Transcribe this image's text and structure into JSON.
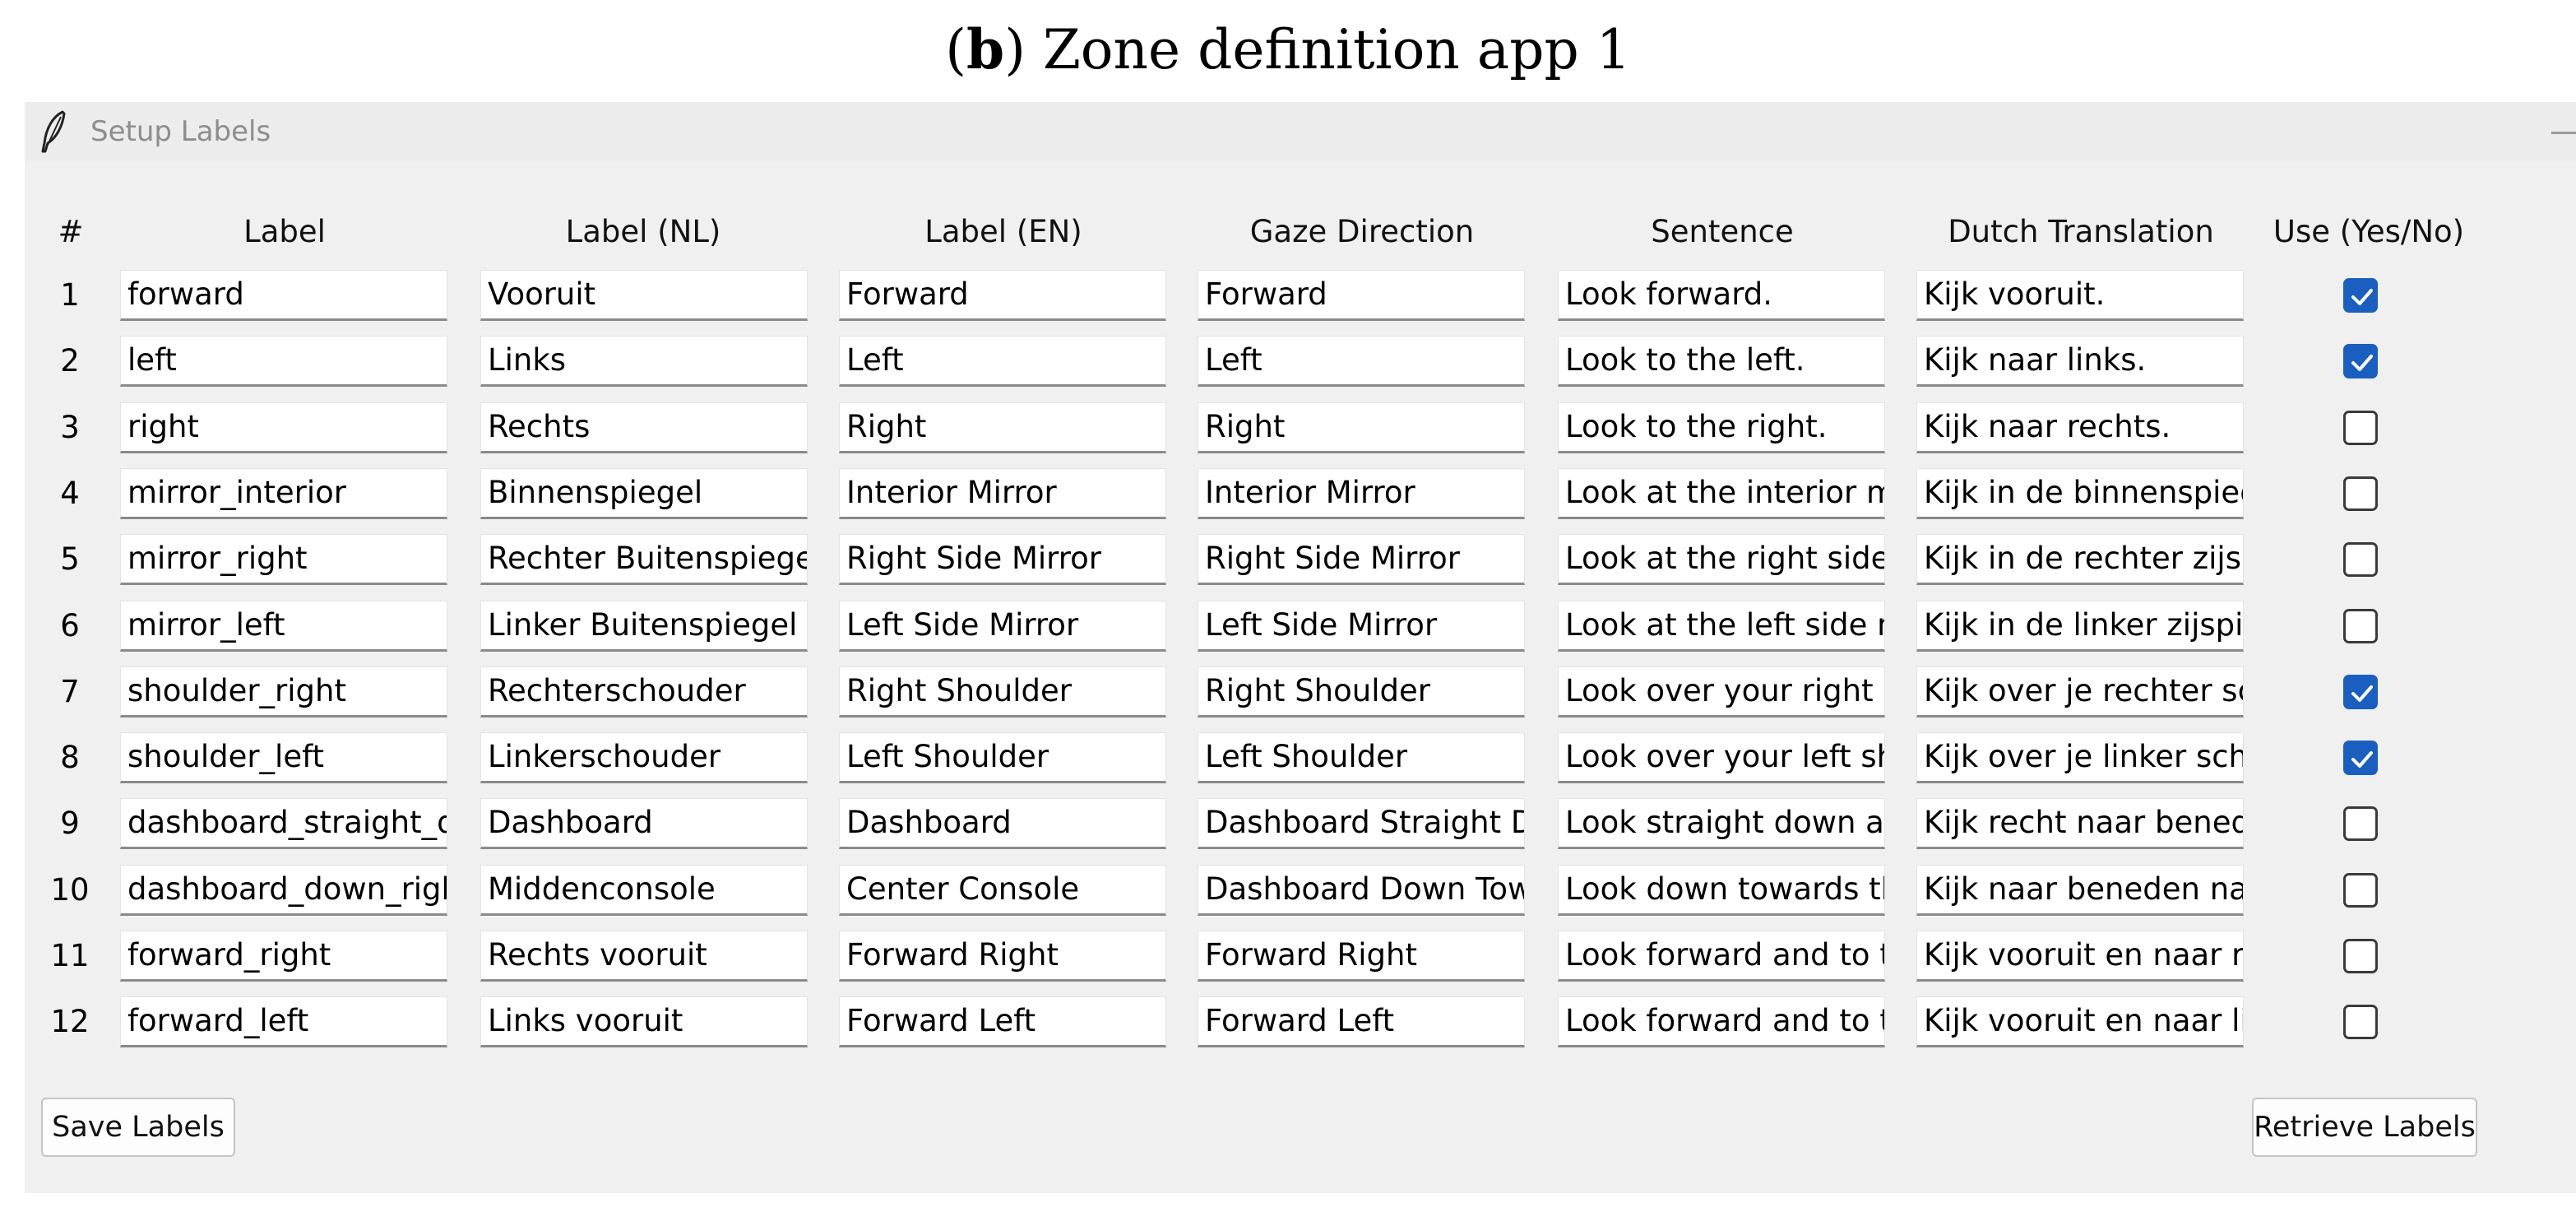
{
  "caption": {
    "panel": "(b)",
    "bold_letter": "b",
    "text": "Zone definition app 1"
  },
  "window": {
    "title": "Setup Labels",
    "icon": "feather-icon"
  },
  "columns": [
    "#",
    "Label",
    "Label (NL)",
    "Label (EN)",
    "Gaze Direction",
    "Sentence",
    "Dutch Translation",
    "Use (Yes/No)"
  ],
  "rows": [
    {
      "num": "1",
      "label": "forward",
      "label_nl": "Vooruit",
      "label_en": "Forward",
      "gaze": "Forward",
      "sentence": "Look forward.",
      "dutch": "Kijk vooruit.",
      "use": true
    },
    {
      "num": "2",
      "label": "left",
      "label_nl": "Links",
      "label_en": "Left",
      "gaze": "Left",
      "sentence": "Look to the left.",
      "dutch": "Kijk naar links.",
      "use": true
    },
    {
      "num": "3",
      "label": "right",
      "label_nl": "Rechts",
      "label_en": "Right",
      "gaze": "Right",
      "sentence": "Look to the right.",
      "dutch": "Kijk naar rechts.",
      "use": false
    },
    {
      "num": "4",
      "label": "mirror_interior",
      "label_nl": "Binnenspiegel",
      "label_en": "Interior Mirror",
      "gaze": "Interior Mirror",
      "sentence": "Look at the interior mir",
      "dutch": "Kijk in de binnenspiege",
      "use": false
    },
    {
      "num": "5",
      "label": "mirror_right",
      "label_nl": "Rechter Buitenspiegel",
      "label_en": "Right Side Mirror",
      "gaze": "Right Side Mirror",
      "sentence": "Look at the right side n",
      "dutch": "Kijk in de rechter zijspie",
      "use": false
    },
    {
      "num": "6",
      "label": "mirror_left",
      "label_nl": "Linker Buitenspiegel",
      "label_en": "Left Side Mirror",
      "gaze": "Left Side Mirror",
      "sentence": "Look at the left side mi",
      "dutch": "Kijk in de linker zijspieg",
      "use": false
    },
    {
      "num": "7",
      "label": "shoulder_right",
      "label_nl": "Rechterschouder",
      "label_en": "Right Shoulder",
      "gaze": "Right Shoulder",
      "sentence": "Look over your right sh",
      "dutch": "Kijk over je rechter sch",
      "use": true
    },
    {
      "num": "8",
      "label": "shoulder_left",
      "label_nl": "Linkerschouder",
      "label_en": "Left Shoulder",
      "gaze": "Left Shoulder",
      "sentence": "Look over your left sho",
      "dutch": "Kijk over je linker schou",
      "use": true
    },
    {
      "num": "9",
      "label": "dashboard_straight_do",
      "label_nl": "Dashboard",
      "label_en": "Dashboard",
      "gaze": "Dashboard Straight Do",
      "sentence": "Look straight down at t",
      "dutch": "Kijk recht naar beneder",
      "use": false
    },
    {
      "num": "10",
      "label": "dashboard_down_right",
      "label_nl": "Middenconsole",
      "label_en": "Center Console",
      "gaze": "Dashboard Down Towa",
      "sentence": "Look down towards the",
      "dutch": "Kijk naar beneden naar",
      "use": false
    },
    {
      "num": "11",
      "label": "forward_right",
      "label_nl": "Rechts vooruit",
      "label_en": "Forward Right",
      "gaze": "Forward Right",
      "sentence": "Look forward and to th",
      "dutch": "Kijk vooruit en naar rec",
      "use": false
    },
    {
      "num": "12",
      "label": "forward_left",
      "label_nl": "Links vooruit",
      "label_en": "Forward Left",
      "gaze": "Forward Left",
      "sentence": "Look forward and to th",
      "dutch": "Kijk vooruit en naar linl",
      "use": false
    }
  ],
  "buttons": {
    "save": "Save Labels",
    "retrieve": "Retrieve Labels"
  },
  "colors": {
    "checkbox_checked": "#1a5fbf",
    "window_bg": "#f0f0f0",
    "field_bg": "#ffffff"
  }
}
